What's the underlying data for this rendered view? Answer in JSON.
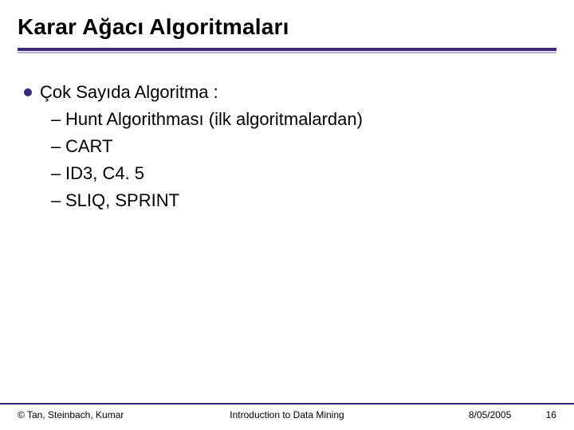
{
  "title": "Karar Ağacı Algoritmaları",
  "top_item": "Çok Sayıda Algoritma :",
  "sub_items": {
    "a": "Hunt Algorithması (ilk algoritmalardan)",
    "b": "CART",
    "c": "ID3, C4. 5",
    "d": "SLIQ, SPRINT"
  },
  "dash": "–",
  "footer": {
    "copyright": "© Tan, Steinbach, Kumar",
    "center": "Introduction to Data Mining",
    "date": "8/05/2005",
    "page": "16"
  }
}
